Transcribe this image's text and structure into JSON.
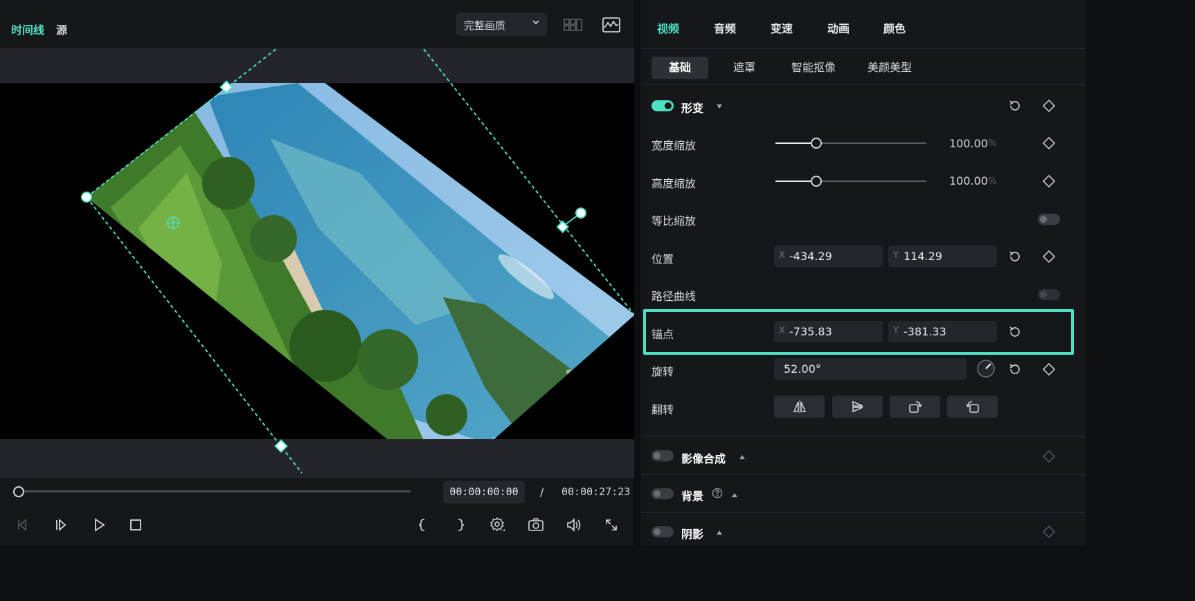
{
  "preview": {
    "tabs": [
      "时间线",
      "源"
    ],
    "quality": "完整画质",
    "timecode": "00:00:00:00",
    "separator": "/",
    "duration": "00:00:27:23",
    "playhead_fraction": 0.0
  },
  "inspector": {
    "tabs": [
      "视频",
      "音频",
      "变速",
      "动画",
      "颜色"
    ],
    "subtabs": [
      "基础",
      "遮罩",
      "智能抠像",
      "美颜美型"
    ],
    "transform": {
      "title": "形变",
      "enabled": true,
      "width_scale": {
        "label": "宽度缩放",
        "value": "100.00",
        "unit": "%",
        "fraction": 0.27
      },
      "height_scale": {
        "label": "高度缩放",
        "value": "100.00",
        "unit": "%",
        "fraction": 0.27
      },
      "uniform_scale": {
        "label": "等比缩放",
        "enabled": false
      },
      "position": {
        "label": "位置",
        "x_axis": "X",
        "x": "-434.29",
        "y_axis": "Y",
        "y": "114.29"
      },
      "path_curve": {
        "label": "路径曲线",
        "enabled": false
      },
      "anchor": {
        "label": "锚点",
        "x_axis": "X",
        "x": "-735.83",
        "y_axis": "Y",
        "y": "-381.33"
      },
      "rotation": {
        "label": "旋转",
        "value": "52.00°"
      },
      "flip": {
        "label": "翻转"
      }
    },
    "compositing": {
      "title": "影像合成",
      "enabled": false
    },
    "background": {
      "title": "背景",
      "enabled": false
    },
    "shadow": {
      "title": "阴影",
      "enabled": false
    }
  },
  "colors": {
    "accent": "#4fe0c2",
    "panel": "#15171b",
    "field": "#23262b"
  }
}
